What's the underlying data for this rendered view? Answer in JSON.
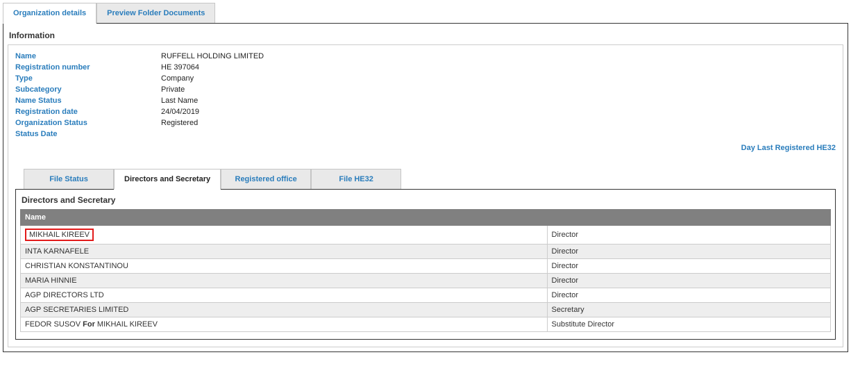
{
  "outerTabs": [
    {
      "label": "Organization details",
      "active": true
    },
    {
      "label": "Preview Folder Documents",
      "active": false
    }
  ],
  "informationTitle": "Information",
  "info": [
    {
      "label": "Name",
      "value": "RUFFELL HOLDING LIMITED"
    },
    {
      "label": "Registration number",
      "value": "ΗΕ 397064"
    },
    {
      "label": "Type",
      "value": "Company"
    },
    {
      "label": "Subcategory",
      "value": "Private"
    },
    {
      "label": "Name Status",
      "value": "Last Name"
    },
    {
      "label": "Registration date",
      "value": "24/04/2019"
    },
    {
      "label": "Organization Status",
      "value": "Registered"
    },
    {
      "label": "Status Date",
      "value": ""
    }
  ],
  "he32Link": "Day Last Registered HE32",
  "innerTabs": [
    {
      "label": "File Status",
      "active": false
    },
    {
      "label": "Directors and Secretary",
      "active": true
    },
    {
      "label": "Registered office",
      "active": false
    },
    {
      "label": "File HE32",
      "active": false
    }
  ],
  "innerPanelTitle": "Directors and Secretary",
  "table": {
    "headers": [
      "Name",
      ""
    ],
    "rows": [
      {
        "name": "MIKHAIL KIREEV",
        "role": "Director",
        "highlight": true
      },
      {
        "name": "INTA KARNAFELE",
        "role": "Director"
      },
      {
        "name": "CHRISTIAN KONSTANTINOU",
        "role": "Director"
      },
      {
        "name": "MARIA HINNIE",
        "role": "Director"
      },
      {
        "name": "AGP DIRECTORS LTD",
        "role": "Director"
      },
      {
        "name": "AGP SECRETARIES LIMITED",
        "role": "Secretary"
      },
      {
        "name1": "FEDOR SUSOV",
        "forWord": "For",
        "name2": "MIKHAIL KIREEV",
        "role": "Substitute Director",
        "compound": true
      }
    ]
  }
}
